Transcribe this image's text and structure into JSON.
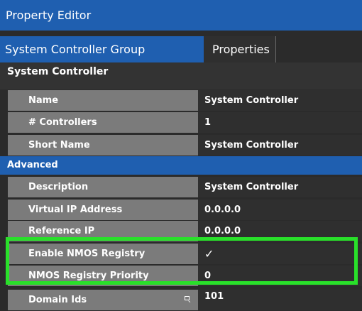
{
  "title": "Property Editor",
  "tabs": [
    {
      "label": "System Controller Group Properties",
      "active": true
    },
    {
      "label": "Properties",
      "active": false
    }
  ],
  "sections": {
    "system": "System Controller",
    "advanced": "Advanced"
  },
  "rows": [
    {
      "label": "Name",
      "value": "System Controller"
    },
    {
      "label": "# Controllers",
      "value": "1"
    },
    {
      "label": "Short Name",
      "value": "System Controller"
    },
    {
      "label": "Description",
      "value": "System Controller"
    },
    {
      "label": "Virtual IP Address",
      "value": "0.0.0.0"
    },
    {
      "label": "Reference IP",
      "value": "0.0.0.0"
    },
    {
      "label": "Enable NMOS Registry",
      "value": "✓",
      "checked": true
    },
    {
      "label": "NMOS Registry Priority",
      "value": "0"
    },
    {
      "label": "Domain Ids",
      "value": "101",
      "icon": "edit-icon"
    }
  ],
  "colors": {
    "accent_blue": "#1f5fb0",
    "highlight_green": "#29e02a",
    "label_bg": "#7b7b7b",
    "value_bg": "#2f2f2f"
  }
}
